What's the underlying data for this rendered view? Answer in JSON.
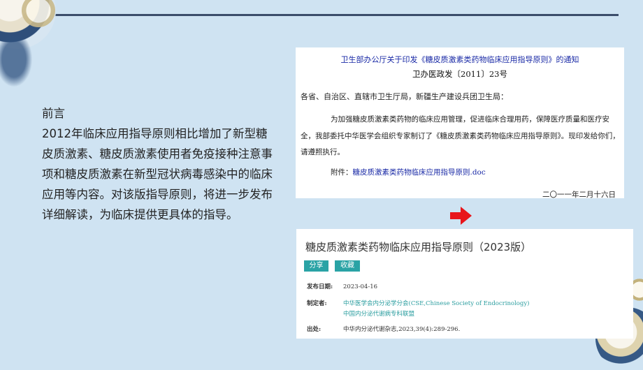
{
  "intro": {
    "heading": "前言",
    "body": "2012年临床应用指导原则相比增加了新型糖皮质激素、糖皮质激素使用者免疫接种注意事项和糖皮质激素在新型冠状病毒感染中的临床应用等内容。对该版指导原则，将进一步发布详细解读，为临床提供更具体的指导。"
  },
  "notice": {
    "title": "卫生部办公厅关于印发《糖皮质激素类药物临床应用指导原则》的通知",
    "doc_number": "卫办医政发〔2011〕23号",
    "addressees": "各省、自治区、直辖市卫生厅局，新疆生产建设兵团卫生局：",
    "body": "为加强糖皮质激素类药物的临床应用管理，促进临床合理用药，保障医疗质量和医疗安全，我部委托中华医学会组织专家制订了《糖皮质激素类药物临床应用指导原则》。现印发给你们，请遵照执行。",
    "attachment_label": "附件：",
    "attachment_link": "糖皮质激素类药物临床应用指导原则.doc",
    "date": "二〇一一年二月十六日"
  },
  "guideline": {
    "title": "糖皮质激素类药物临床应用指导原则（2023版）",
    "share_label": "分享",
    "favorite_label": "收藏",
    "publish_date_label": "发布日期:",
    "publish_date": "2023-04-16",
    "author_label": "制定者:",
    "author_line1": "中华医学会内分泌学分会(CSE,Chinese Society of Endocrinology)",
    "author_line2": "中国内分泌代谢病专科联盟",
    "source_label": "出处:",
    "source": "中华内分泌代谢杂志,2023,39(4):289-296."
  },
  "colors": {
    "background": "#cfe3f2",
    "rule": "#3b4d6b",
    "notice_title": "#1a2aa6",
    "teal": "#2aa3a5",
    "arrow": "#e8151b"
  },
  "icons": {
    "arrow": "right-arrow-icon"
  }
}
